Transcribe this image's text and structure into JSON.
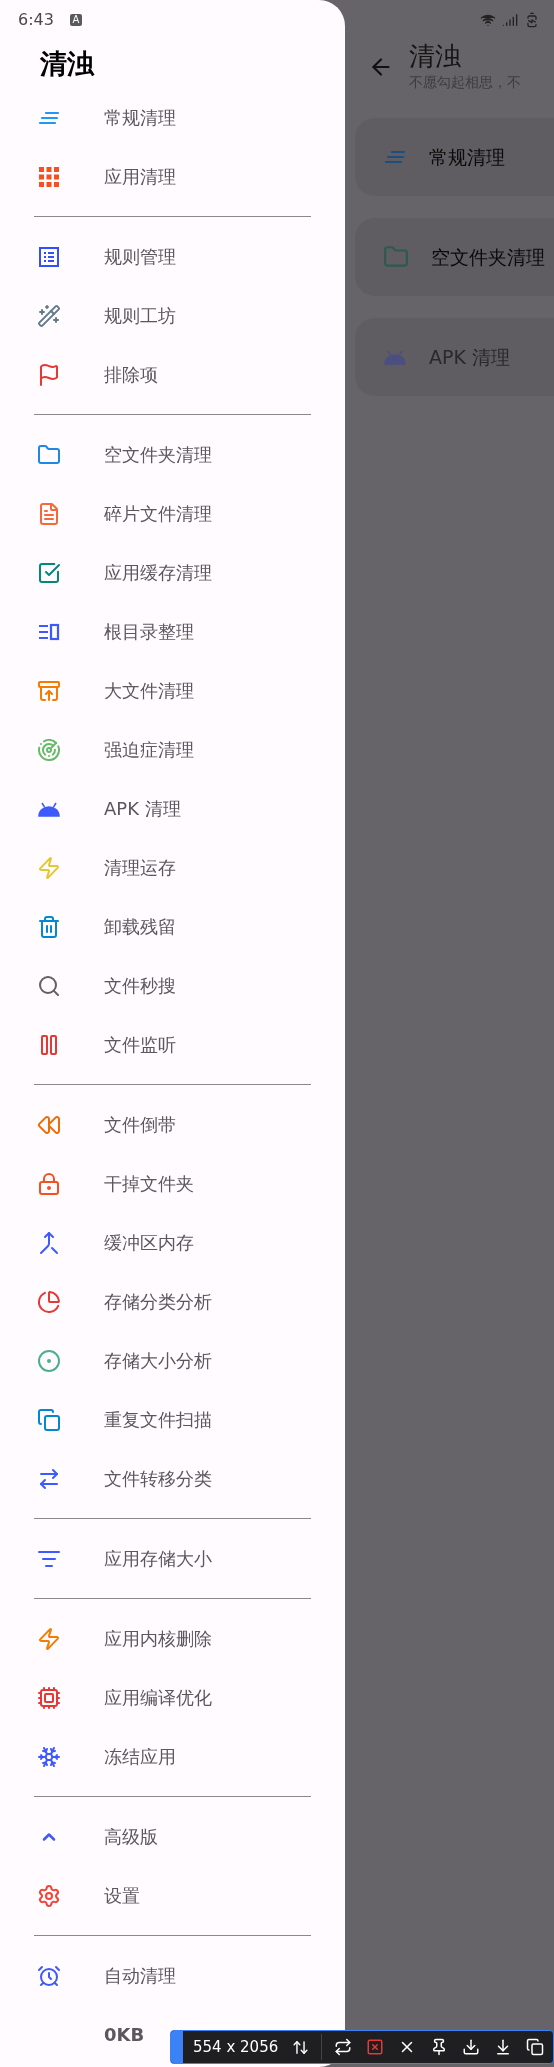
{
  "status_bar": {
    "time": "6:43",
    "badge": "A"
  },
  "drawer": {
    "title": "清浊",
    "groups": [
      [
        {
          "label": "常规清理",
          "color": "#2196f3"
        },
        {
          "label": "应用清理",
          "color": "#f4511e"
        }
      ],
      [
        {
          "label": "规则管理",
          "color": "#304ffe"
        },
        {
          "label": "规则工坊",
          "color": "#607d8b"
        },
        {
          "label": "排除项",
          "color": "#e53935"
        }
      ],
      [
        {
          "label": "空文件夹清理",
          "color": "#1e88e5"
        },
        {
          "label": "碎片文件清理",
          "color": "#f4683c"
        },
        {
          "label": "应用缓存清理",
          "color": "#00897b"
        },
        {
          "label": "根目录整理",
          "color": "#3d5afe"
        },
        {
          "label": "大文件清理",
          "color": "#f57c00"
        },
        {
          "label": "强迫症清理",
          "color": "#66bb6a"
        },
        {
          "label": "APK 清理",
          "color": "#3d5afe"
        },
        {
          "label": "清理运存",
          "color": "#e2c930"
        },
        {
          "label": "卸载残留",
          "color": "#0288d1"
        },
        {
          "label": "文件秒搜",
          "color": "#616161"
        },
        {
          "label": "文件监听",
          "color": "#e53935"
        }
      ],
      [
        {
          "label": "文件倒带",
          "color": "#ef6c00"
        },
        {
          "label": "干掉文件夹",
          "color": "#f4511e"
        },
        {
          "label": "缓冲区内存",
          "color": "#3d5afe"
        },
        {
          "label": "存储分类分析",
          "color": "#e53935"
        },
        {
          "label": "存储大小分析",
          "color": "#4caf8f"
        },
        {
          "label": "重复文件扫描",
          "color": "#0288d1"
        },
        {
          "label": "文件转移分类",
          "color": "#3d5afe"
        }
      ],
      [
        {
          "label": "应用存储大小",
          "color": "#3d5afe"
        }
      ],
      [
        {
          "label": "应用内核删除",
          "color": "#f57c00"
        },
        {
          "label": "应用编译优化",
          "color": "#e53935"
        },
        {
          "label": "冻结应用",
          "color": "#3d5afe"
        }
      ],
      [
        {
          "label": "高级版",
          "color": "#3d5afe"
        },
        {
          "label": "设置",
          "color": "#f44336"
        }
      ],
      [
        {
          "label": "自动清理",
          "color": "#3d5afe"
        }
      ]
    ],
    "footer": "0KB"
  },
  "app": {
    "title": "清浊",
    "subtitle": "不愿勾起相思，不",
    "cards": [
      {
        "label": "常规清理",
        "disabled": false
      },
      {
        "label": "空文件夹清理",
        "disabled": false
      },
      {
        "label": "APK 清理",
        "disabled": true
      }
    ]
  },
  "toolbar": {
    "label": "554 x 2056"
  }
}
